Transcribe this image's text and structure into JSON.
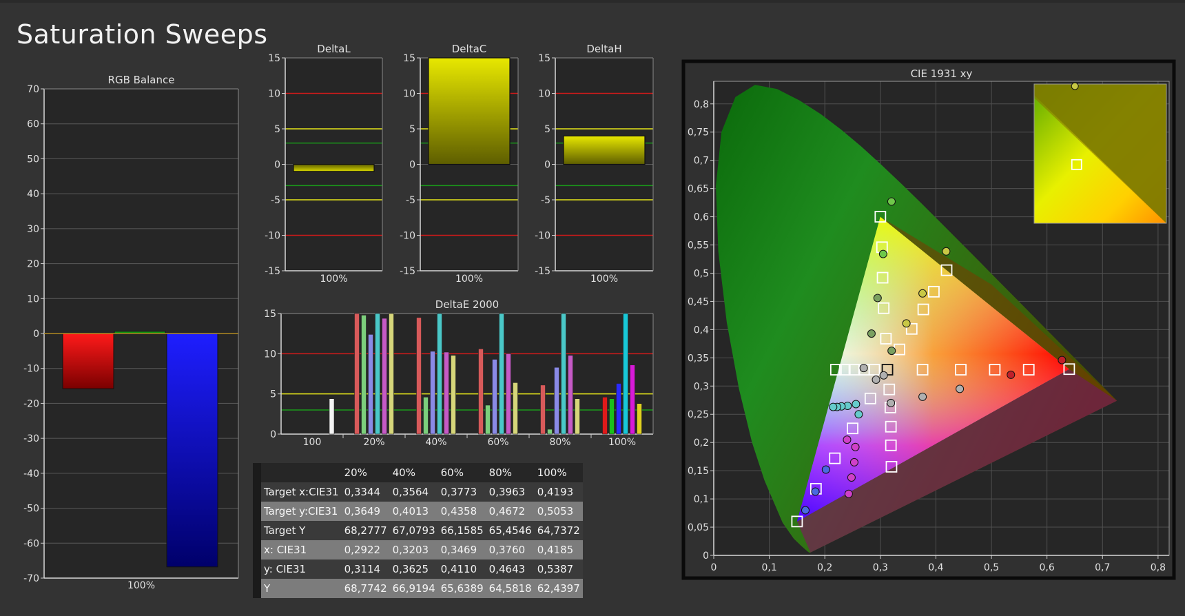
{
  "page_title": "Saturation Sweeps",
  "colors": {
    "background": "#333333",
    "plot_bg": "#262626",
    "red_threshold": "#d01a1a",
    "yellow_threshold": "#e6e61a",
    "green_threshold": "#1a9a1a"
  },
  "chart_data": [
    {
      "id": "rgb_balance",
      "type": "bar",
      "title": "RGB Balance",
      "categories": [
        "100%"
      ],
      "series": [
        {
          "color": "red",
          "values": [
            -15.8
          ]
        },
        {
          "color": "green",
          "values": [
            0.6
          ]
        },
        {
          "color": "blue",
          "values": [
            -66.8
          ]
        }
      ],
      "ylim": [
        -70,
        70
      ],
      "yticks": [
        "70",
        "60",
        "50",
        "40",
        "30",
        "20",
        "10",
        "0",
        "-10",
        "-20",
        "-30",
        "-40",
        "-50",
        "-60",
        "-70"
      ],
      "yticks_values": [
        70,
        60,
        50,
        40,
        30,
        20,
        10,
        0,
        -10,
        -20,
        -30,
        -40,
        -50,
        -60,
        -70
      ]
    },
    {
      "id": "delta_l",
      "type": "bar",
      "title": "DeltaL",
      "categories": [
        "100%"
      ],
      "values": [
        -1.0
      ],
      "ylim": [
        -15,
        15
      ],
      "yticks": [
        "15",
        "10",
        "5",
        "0",
        "-5",
        "-10",
        "-15"
      ],
      "yticks_values": [
        15,
        10,
        5,
        0,
        -5,
        -10,
        -15
      ],
      "thresholds": [
        10,
        5,
        3,
        -3,
        -5,
        -10
      ]
    },
    {
      "id": "delta_c",
      "type": "bar",
      "title": "DeltaC",
      "categories": [
        "100%"
      ],
      "values": [
        15.0
      ],
      "ylim": [
        -15,
        15
      ],
      "yticks": [
        "15",
        "10",
        "5",
        "0",
        "-5",
        "-10",
        "-15"
      ],
      "yticks_values": [
        15,
        10,
        5,
        0,
        -5,
        -10,
        -15
      ],
      "thresholds": [
        10,
        5,
        3,
        -3,
        -5,
        -10
      ]
    },
    {
      "id": "delta_h",
      "type": "bar",
      "title": "DeltaH",
      "categories": [
        "100%"
      ],
      "values": [
        4.0
      ],
      "ylim": [
        -15,
        15
      ],
      "yticks": [
        "15",
        "10",
        "5",
        "0",
        "-5",
        "-10",
        "-15"
      ],
      "yticks_values": [
        15,
        10,
        5,
        0,
        -5,
        -10,
        -15
      ],
      "thresholds": [
        10,
        5,
        3,
        -3,
        -5,
        -10
      ]
    },
    {
      "id": "delta_e_2000",
      "type": "bar",
      "title": "DeltaE 2000",
      "categories": [
        "100",
        "20%",
        "40%",
        "60%",
        "80%",
        "100%"
      ],
      "series": [
        {
          "color": "white",
          "values": [
            4.4,
            null,
            null,
            null,
            null,
            null
          ]
        },
        {
          "color": "red",
          "values": [
            null,
            15.0,
            14.5,
            10.6,
            6.1,
            4.6
          ]
        },
        {
          "color": "green",
          "values": [
            null,
            14.8,
            4.6,
            3.6,
            0.6,
            4.4
          ]
        },
        {
          "color": "blue",
          "values": [
            null,
            12.4,
            10.3,
            9.3,
            8.3,
            6.3
          ]
        },
        {
          "color": "cyan",
          "values": [
            null,
            15.0,
            15.0,
            15.0,
            15.0,
            15.0
          ]
        },
        {
          "color": "magenta",
          "values": [
            null,
            14.4,
            10.2,
            10.0,
            9.8,
            8.6
          ]
        },
        {
          "color": "yellow",
          "values": [
            null,
            15.0,
            9.8,
            6.4,
            4.4,
            3.8
          ]
        }
      ],
      "ylim": [
        0,
        15
      ],
      "yticks": [
        "15",
        "10",
        "5",
        "0"
      ],
      "yticks_values": [
        15,
        10,
        5,
        0
      ],
      "thresholds": [
        10,
        5,
        3
      ]
    },
    {
      "id": "cie_1931_xy",
      "type": "scatter",
      "title": "CIE 1931 xy",
      "xlim": [
        0,
        0.82
      ],
      "ylim": [
        0,
        0.84
      ],
      "xticks": [
        "0",
        "0,1",
        "0,2",
        "0,3",
        "0,4",
        "0,5",
        "0,6",
        "0,7",
        "0,8"
      ],
      "xticks_values": [
        0,
        0.1,
        0.2,
        0.3,
        0.4,
        0.5,
        0.6,
        0.7,
        0.8
      ],
      "yticks": [
        "0",
        "0,05",
        "0,1",
        "0,15",
        "0,2",
        "0,25",
        "0,3",
        "0,35",
        "0,4",
        "0,45",
        "0,5",
        "0,55",
        "0,6",
        "0,65",
        "0,7",
        "0,75",
        "0,8"
      ],
      "yticks_values": [
        0,
        0.05,
        0.1,
        0.15,
        0.2,
        0.25,
        0.3,
        0.35,
        0.4,
        0.45,
        0.5,
        0.55,
        0.6,
        0.65,
        0.7,
        0.75,
        0.8
      ],
      "gamut_triangle": [
        [
          0.64,
          0.33
        ],
        [
          0.3,
          0.6
        ],
        [
          0.15,
          0.06
        ]
      ],
      "white_point": [
        0.3127,
        0.329
      ],
      "targets": [
        [
          0.3127,
          0.329
        ],
        [
          0.376,
          0.329
        ],
        [
          0.4448,
          0.329
        ],
        [
          0.506,
          0.329
        ],
        [
          0.5672,
          0.329
        ],
        [
          0.64,
          0.33
        ],
        [
          0.289,
          0.329
        ],
        [
          0.2707,
          0.329
        ],
        [
          0.2531,
          0.329
        ],
        [
          0.236,
          0.329
        ],
        [
          0.22,
          0.329
        ],
        [
          0.31,
          0.384
        ],
        [
          0.306,
          0.438
        ],
        [
          0.304,
          0.492
        ],
        [
          0.303,
          0.546
        ],
        [
          0.3,
          0.6
        ],
        [
          0.3344,
          0.3649
        ],
        [
          0.3564,
          0.4013
        ],
        [
          0.3773,
          0.4358
        ],
        [
          0.3963,
          0.4672
        ],
        [
          0.4193,
          0.5053
        ],
        [
          0.282,
          0.278
        ],
        [
          0.25,
          0.225
        ],
        [
          0.218,
          0.172
        ],
        [
          0.184,
          0.118
        ],
        [
          0.15,
          0.06
        ],
        [
          0.316,
          0.294
        ],
        [
          0.318,
          0.262
        ],
        [
          0.319,
          0.228
        ],
        [
          0.319,
          0.195
        ],
        [
          0.32,
          0.157
        ]
      ],
      "measured": [
        [
          0.627,
          0.346
        ],
        [
          0.535,
          0.32
        ],
        [
          0.443,
          0.295
        ],
        [
          0.376,
          0.281
        ],
        [
          0.256,
          0.268
        ],
        [
          0.241,
          0.265
        ],
        [
          0.23,
          0.264
        ],
        [
          0.222,
          0.263
        ],
        [
          0.215,
          0.263
        ],
        [
          0.32,
          0.627
        ],
        [
          0.305,
          0.534
        ],
        [
          0.295,
          0.456
        ],
        [
          0.284,
          0.393
        ],
        [
          0.27,
          0.332
        ],
        [
          0.2922,
          0.3114
        ],
        [
          0.3203,
          0.3625
        ],
        [
          0.3469,
          0.411
        ],
        [
          0.376,
          0.4643
        ],
        [
          0.4185,
          0.5387
        ],
        [
          0.261,
          0.25
        ],
        [
          0.24,
          0.205
        ],
        [
          0.202,
          0.152
        ],
        [
          0.183,
          0.113
        ],
        [
          0.165,
          0.08
        ],
        [
          0.306,
          0.319
        ],
        [
          0.319,
          0.27
        ],
        [
          0.255,
          0.192
        ],
        [
          0.253,
          0.165
        ],
        [
          0.248,
          0.138
        ],
        [
          0.243,
          0.109
        ]
      ]
    }
  ],
  "table": {
    "headers": [
      "20%",
      "40%",
      "60%",
      "80%",
      "100%"
    ],
    "rows": [
      {
        "label": "Target x:CIE31",
        "values": [
          "0,3344",
          "0,3564",
          "0,3773",
          "0,3963",
          "0,4193"
        ]
      },
      {
        "label": "Target y:CIE31",
        "values": [
          "0,3649",
          "0,4013",
          "0,4358",
          "0,4672",
          "0,5053"
        ]
      },
      {
        "label": "Target Y",
        "values": [
          "68,2777",
          "67,0793",
          "66,1585",
          "65,4546",
          "64,7372"
        ]
      },
      {
        "label": "x: CIE31",
        "values": [
          "0,2922",
          "0,3203",
          "0,3469",
          "0,3760",
          "0,4185"
        ]
      },
      {
        "label": "y: CIE31",
        "values": [
          "0,3114",
          "0,3625",
          "0,4110",
          "0,4643",
          "0,5387"
        ]
      },
      {
        "label": "Y",
        "values": [
          "68,7742",
          "66,9194",
          "65,6389",
          "64,5818",
          "62,4397"
        ]
      }
    ]
  }
}
